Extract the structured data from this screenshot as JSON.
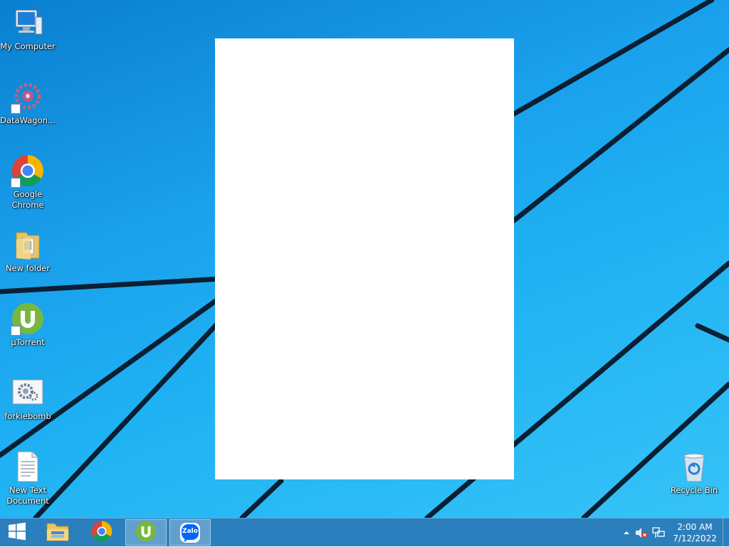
{
  "desktop": {
    "icons": [
      {
        "label": "My Computer",
        "icon": "computer-icon"
      },
      {
        "label": "DataWagon...",
        "icon": "gear-cluster-icon"
      },
      {
        "label": "Google Chrome",
        "icon": "chrome-icon"
      },
      {
        "label": "New folder",
        "icon": "folder-icon"
      },
      {
        "label": "µTorrent",
        "icon": "utorrent-icon"
      },
      {
        "label": "forkiebomb",
        "icon": "settings-file-icon"
      },
      {
        "label": "New Text Document",
        "icon": "text-document-icon"
      },
      {
        "label": "Recycle Bin",
        "icon": "recycle-bin-icon"
      }
    ]
  },
  "window": {
    "app": "Zalo",
    "background": "#ffffff"
  },
  "taskbar": {
    "start_icon": "windows-logo-icon",
    "pinned": [
      {
        "name": "File Explorer",
        "icon": "file-explorer-icon",
        "active": false
      },
      {
        "name": "Google Chrome",
        "icon": "chrome-icon",
        "active": false
      },
      {
        "name": "µTorrent",
        "icon": "utorrent-icon",
        "active": true
      },
      {
        "name": "Zalo",
        "icon": "zalo-icon",
        "label": "Zalo",
        "active": true
      }
    ],
    "tray": {
      "show_hidden_icon": "chevron-up-icon",
      "volume_icon": "speaker-muted-icon",
      "network_icon": "network-icon",
      "time": "2:00 AM",
      "date": "7/12/2022"
    }
  },
  "colors": {
    "desktop_blue": "#1aa0ec",
    "taskbar": "#2c7fbd",
    "zalo_blue": "#0068ff",
    "utorrent_green": "#76b83f"
  }
}
